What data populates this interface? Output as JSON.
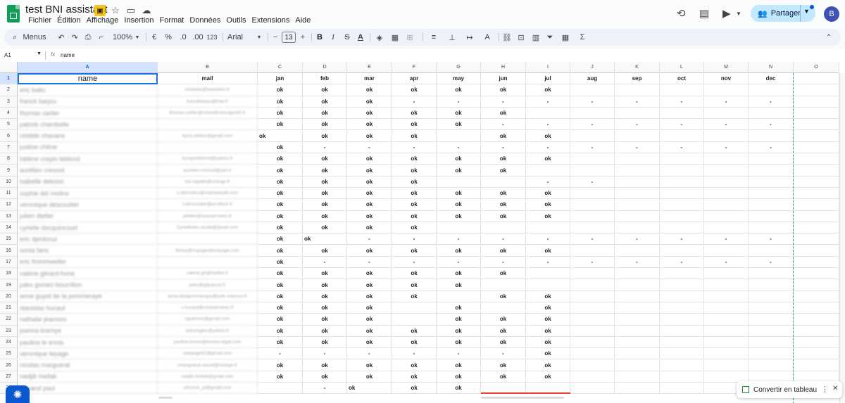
{
  "app": {
    "title": "test BNI assistant",
    "menus": [
      "Fichier",
      "Édition",
      "Affichage",
      "Insertion",
      "Format",
      "Données",
      "Outils",
      "Extensions",
      "Aide"
    ],
    "share_label": "Partager",
    "avatar_letter": "B"
  },
  "toolbar": {
    "menus_label": "Menus",
    "zoom": "100%",
    "currency": "€",
    "percent": "%",
    "dec_less": ".0",
    "dec_more": ".00",
    "number_format": "123",
    "font": "Arial",
    "font_size": "13",
    "minus": "−",
    "plus": "+",
    "bold": "B",
    "sigma": "Σ"
  },
  "formula_bar": {
    "cell_ref": "A1",
    "fx": "fx",
    "value": "name"
  },
  "columns": [
    "A",
    "B",
    "C",
    "D",
    "E",
    "F",
    "G",
    "H",
    "I",
    "J",
    "K",
    "L",
    "M",
    "N",
    "O"
  ],
  "header_row": [
    "name",
    "mail",
    "jan",
    "feb",
    "mar",
    "apr",
    "may",
    "jun",
    "jul",
    "aug",
    "sep",
    "oct",
    "nov",
    "dec"
  ],
  "rows": [
    {
      "n": "2",
      "name": "eric baltu",
      "mail": "ericbaltu@wanadoo.fr",
      "v": [
        "ok",
        "ok",
        "ok",
        "ok",
        "ok",
        "ok",
        "ok",
        "",
        "",
        "",
        "",
        ""
      ]
    },
    {
      "n": "3",
      "name": "franck barjou",
      "mail": "franckbarjou@free.fr",
      "v": [
        "ok",
        "ok",
        "ok",
        "-",
        "-",
        "-",
        "-",
        "-",
        "-",
        "-",
        "-",
        "-"
      ]
    },
    {
      "n": "4",
      "name": "thomas carlier",
      "mail": "thomas.carlier@schmidt-bourges92.fr",
      "v": [
        "ok",
        "ok",
        "ok",
        "ok",
        "ok",
        "ok",
        "",
        "",
        "",
        "",
        "",
        ""
      ]
    },
    {
      "n": "5",
      "name": "patrick chambelle",
      "mail": "",
      "v": [
        "ok",
        "ok",
        "ok",
        "ok",
        "ok",
        "-",
        "-",
        "-",
        "-",
        "-",
        "-",
        "-"
      ]
    },
    {
      "n": "6",
      "name": "clotilde chavane",
      "mail": "bycls.editios@gmail.com",
      "v": [
        "ok",
        "ok",
        "ok",
        "ok",
        "",
        "ok",
        "ok",
        "",
        "",
        "",
        "",
        ""
      ]
    },
    {
      "n": "7",
      "name": "justine chêne",
      "mail": "",
      "v": [
        "ok",
        "-",
        "-",
        "-",
        "-",
        "-",
        "-",
        "-",
        "-",
        "-",
        "-",
        "-"
      ]
    },
    {
      "n": "8",
      "name": "hélène crepin leblond",
      "mail": "hcrepinleblond@yahoo.fr",
      "v": [
        "ok",
        "ok",
        "ok",
        "ok",
        "ok",
        "ok",
        "ok",
        "",
        "",
        "",
        "",
        ""
      ]
    },
    {
      "n": "9",
      "name": "aurélien cressot",
      "mail": "aurelien.cressot@yan.fr",
      "v": [
        "ok",
        "ok",
        "ok",
        "ok",
        "ok",
        "ok",
        "",
        "",
        "",
        "",
        "",
        ""
      ]
    },
    {
      "n": "10",
      "name": "isabelle dekoon",
      "mail": "isa.zapatte@orange.fr",
      "v": [
        "ok",
        "ok",
        "ok",
        "ok",
        "",
        "",
        "-",
        "-",
        "",
        "",
        "",
        ""
      ]
    },
    {
      "n": "11",
      "name": "sophie del molino",
      "mail": "s.delmolino@sophieaudit.com",
      "v": [
        "ok",
        "ok",
        "ok",
        "ok",
        "ok",
        "ok",
        "ok",
        "",
        "",
        "",
        "",
        ""
      ]
    },
    {
      "n": "12",
      "name": "veronique descoutter",
      "mail": "v.descoutter@ecoflock.fr",
      "v": [
        "ok",
        "ok",
        "ok",
        "ok",
        "ok",
        "ok",
        "ok",
        "",
        "",
        "",
        "",
        ""
      ]
    },
    {
      "n": "13",
      "name": "julien dietler",
      "mail": "jdietler@assuservices.fr",
      "v": [
        "ok",
        "ok",
        "ok",
        "ok",
        "ok",
        "ok",
        "ok",
        "",
        "",
        "",
        "",
        ""
      ]
    },
    {
      "n": "14",
      "name": "cyrielle docquincourt",
      "mail": "Cyrielledoc.studio@gmail.com",
      "v": [
        "ok",
        "ok",
        "ok",
        "ok",
        "",
        "",
        "",
        "",
        "",
        "",
        "",
        ""
      ]
    },
    {
      "n": "15",
      "name": "eric djenbouz",
      "mail": "",
      "v": [
        "ok",
        "ok",
        "-",
        "-",
        "-",
        "-",
        "-",
        "-",
        "-",
        "-",
        "-",
        "-"
      ]
    },
    {
      "n": "16",
      "name": "sonia faris",
      "mail": "fbnisa@voyagesdevoyage.com",
      "v": [
        "ok",
        "ok",
        "ok",
        "ok",
        "ok",
        "ok",
        "ok",
        "",
        "",
        "",
        "",
        ""
      ]
    },
    {
      "n": "17",
      "name": "eric frommweiler",
      "mail": "",
      "v": [
        "ok",
        "-",
        "-",
        "-",
        "-",
        "-",
        "-",
        "-",
        "-",
        "-",
        "-",
        "-"
      ]
    },
    {
      "n": "18",
      "name": "valérie gérard-hone",
      "mail": "valerie.gh@hotlike.fr",
      "v": [
        "ok",
        "ok",
        "ok",
        "ok",
        "ok",
        "ok",
        "",
        "",
        "",
        "",
        "",
        ""
      ]
    },
    {
      "n": "19",
      "name": "jules gomez-bourrillon",
      "mail": "jules@gbpascal.fr",
      "v": [
        "ok",
        "ok",
        "ok",
        "ok",
        "ok",
        "",
        "",
        "",
        "",
        "",
        "",
        ""
      ]
    },
    {
      "n": "20",
      "name": "anne guyot de la pommeraye",
      "mail": "anne.delapommeraye@pole-miamos.fr",
      "v": [
        "ok",
        "ok",
        "ok",
        "ok",
        "",
        "ok",
        "ok",
        "",
        "",
        "",
        "",
        ""
      ]
    },
    {
      "n": "21",
      "name": "stanislas hucaut",
      "mail": "s.hucaut@crediservices.fr",
      "v": [
        "ok",
        "ok",
        "ok",
        "",
        "ok",
        "",
        "ok",
        "",
        "",
        "",
        "",
        ""
      ]
    },
    {
      "n": "22",
      "name": "nathalie jeamoro",
      "mail": "njeamoro@gmail.com",
      "v": [
        "ok",
        "ok",
        "ok",
        "",
        "ok",
        "ok",
        "ok",
        "",
        "",
        "",
        "",
        ""
      ]
    },
    {
      "n": "23",
      "name": "joanna kremye",
      "mail": "askemglen@yahoo.fr",
      "v": [
        "ok",
        "ok",
        "ok",
        "ok",
        "ok",
        "ok",
        "ok",
        "",
        "",
        "",
        "",
        ""
      ]
    },
    {
      "n": "24",
      "name": "pauline le ennis",
      "mail": "pauline.lennis@lennex-legal.com",
      "v": [
        "ok",
        "ok",
        "ok",
        "ok",
        "ok",
        "ok",
        "ok",
        "",
        "",
        "",
        "",
        ""
      ]
    },
    {
      "n": "25",
      "name": "veronique lepage",
      "mail": "valepage92@gmail.com",
      "v": [
        "-",
        "-",
        "-",
        "-",
        "-",
        "-",
        "ok",
        "",
        "",
        "",
        "",
        ""
      ]
    },
    {
      "n": "26",
      "name": "nicolas marguerat",
      "mail": "nmarguerat.excud@orange.fr",
      "v": [
        "ok",
        "ok",
        "ok",
        "ok",
        "ok",
        "ok",
        "ok",
        "",
        "",
        "",
        "",
        ""
      ]
    },
    {
      "n": "27",
      "name": "nadjib mellak",
      "mail": "nadjib.mellak@gmail.com",
      "v": [
        "ok",
        "ok",
        "ok",
        "ok",
        "ok",
        "ok",
        "ok",
        "",
        "",
        "",
        "",
        ""
      ]
    },
    {
      "n": "28",
      "name": "armand paul",
      "mail": "ohmsmi_pl@gmail.com",
      "v": [
        "",
        "-",
        "ok",
        "ok",
        "ok",
        "",
        "",
        "",
        "",
        "",
        "",
        ""
      ]
    }
  ],
  "overlays": {
    "convert_label": "Convertir en tableau"
  }
}
